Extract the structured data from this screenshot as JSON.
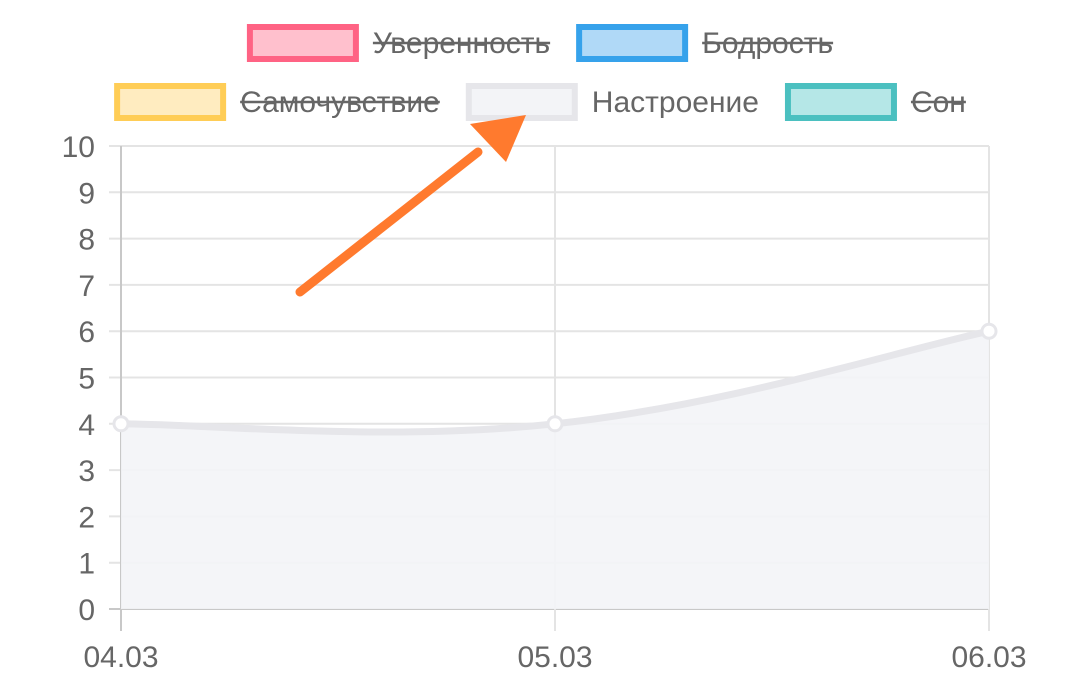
{
  "chart_data": {
    "type": "line",
    "categories": [
      "04.03",
      "05.03",
      "06.03"
    ],
    "series": [
      {
        "name": "Уверенность",
        "hidden": true,
        "border": "#ff6384",
        "fill": "#ffc0cd",
        "values": []
      },
      {
        "name": "Бодрость",
        "hidden": true,
        "border": "#36a2eb",
        "fill": "#b0d9f7",
        "values": []
      },
      {
        "name": "Самочувствие",
        "hidden": true,
        "border": "#ffcd56",
        "fill": "#ffecc0",
        "values": []
      },
      {
        "name": "Настроение",
        "hidden": false,
        "border": "#e6e6ea",
        "fill": "#f3f4f7",
        "values": [
          4,
          4,
          6
        ]
      },
      {
        "name": "Сон",
        "hidden": true,
        "border": "#4bc0c0",
        "fill": "#b5e7e7",
        "values": []
      }
    ],
    "yticks": [
      "0",
      "1",
      "2",
      "3",
      "4",
      "5",
      "6",
      "7",
      "8",
      "9",
      "10"
    ],
    "ylim": [
      0,
      10
    ],
    "grid": true,
    "legend_position": "top"
  },
  "annotation": {
    "type": "arrow",
    "color": "#ff7a2e",
    "points_to": "Настроение"
  }
}
